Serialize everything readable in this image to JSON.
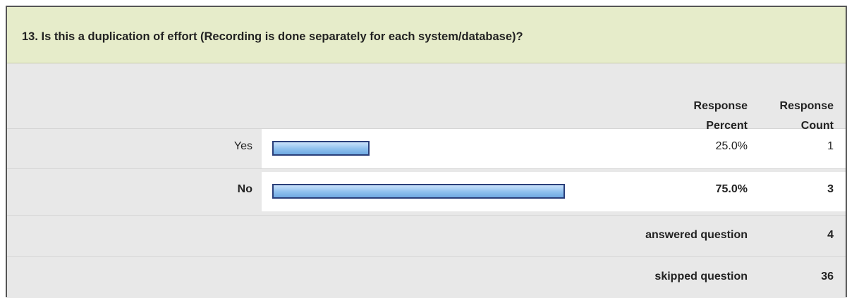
{
  "question": {
    "title": "13. Is this a duplication of effort (Recording is done separately for each system/database)?"
  },
  "header": {
    "response_percent": "Response Percent",
    "response_count": "Response Count"
  },
  "rows": [
    {
      "label": "Yes",
      "percent_text": "25.0%",
      "count": "1"
    },
    {
      "label": "No",
      "percent_text": "75.0%",
      "count": "3"
    }
  ],
  "summary": {
    "answered_label": "answered question",
    "answered_value": "4",
    "skipped_label": "skipped question",
    "skipped_value": "36"
  },
  "colors": {
    "header_bg": "#e6ecca",
    "bar_fill": "#8fc0ee",
    "bar_border": "#2a3f7a"
  },
  "chart_data": {
    "type": "bar",
    "categories": [
      "Yes",
      "No"
    ],
    "values": [
      25.0,
      75.0
    ],
    "counts": [
      1,
      3
    ],
    "xlim": [
      0,
      100
    ]
  }
}
